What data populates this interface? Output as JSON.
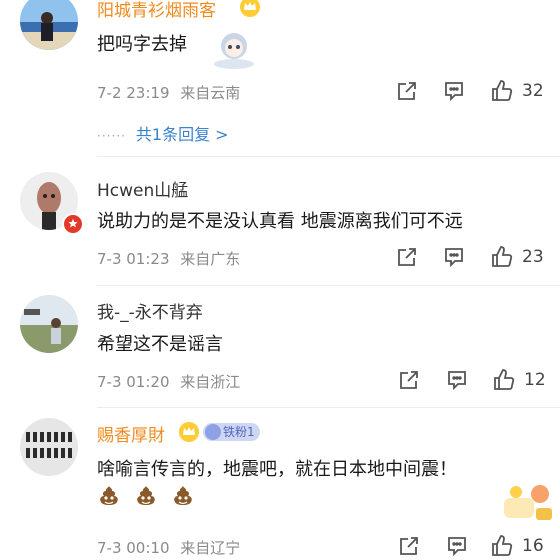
{
  "comments": [
    {
      "username": "阳城青衫烟雨客",
      "text": "把吗字去掉",
      "date": "7-2 23:19",
      "location": "来自云南",
      "likes": "32",
      "reply_link": "共1条回复 >"
    },
    {
      "username": "Hcwen山艋",
      "text": "说助力的是不是没认真看 地震源离我们可不远",
      "date": "7-3 01:23",
      "location": "来自广东",
      "likes": "23"
    },
    {
      "username": "我-_-永不背弃",
      "text": "希望这不是谣言",
      "date": "7-3 01:20",
      "location": "来自浙江",
      "likes": "12"
    },
    {
      "username": "赐香厚財",
      "fan_badge": "铁粉1",
      "text": "啥喻言传言的，地震吧，就在日本地中间震！",
      "date": "7-3 00:10",
      "location": "来自辽宁",
      "likes": "16"
    }
  ],
  "colors": {
    "vip_name": "#f08a1c",
    "link": "#3b82d0",
    "meta": "#8a8a8a"
  },
  "icons": [
    "share-icon",
    "comment-icon",
    "like-icon",
    "vip-crown-icon",
    "poop-emoji"
  ]
}
